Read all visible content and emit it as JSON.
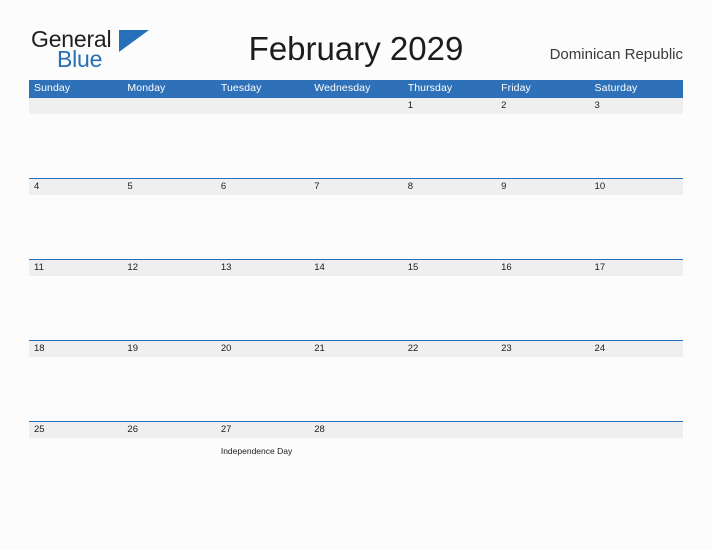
{
  "brand": {
    "name_part1": "General",
    "name_part2": "Blue",
    "icon": "blue-triangle-logo-mark",
    "color_primary": "#2570b8",
    "color_text": "#231f20"
  },
  "header": {
    "title": "February 2029",
    "region": "Dominican Republic"
  },
  "calendar": {
    "month": "February",
    "year": "2029",
    "header_background": "#2e71b8",
    "header_text_color": "#ffffff",
    "date_band_background": "#efefef",
    "row_border_color": "#2570b8",
    "weekdays": [
      "Sunday",
      "Monday",
      "Tuesday",
      "Wednesday",
      "Thursday",
      "Friday",
      "Saturday"
    ],
    "weeks": [
      {
        "days": [
          {
            "date": "",
            "events": []
          },
          {
            "date": "",
            "events": []
          },
          {
            "date": "",
            "events": []
          },
          {
            "date": "",
            "events": []
          },
          {
            "date": "1",
            "events": []
          },
          {
            "date": "2",
            "events": []
          },
          {
            "date": "3",
            "events": []
          }
        ]
      },
      {
        "days": [
          {
            "date": "4",
            "events": []
          },
          {
            "date": "5",
            "events": []
          },
          {
            "date": "6",
            "events": []
          },
          {
            "date": "7",
            "events": []
          },
          {
            "date": "8",
            "events": []
          },
          {
            "date": "9",
            "events": []
          },
          {
            "date": "10",
            "events": []
          }
        ]
      },
      {
        "days": [
          {
            "date": "11",
            "events": []
          },
          {
            "date": "12",
            "events": []
          },
          {
            "date": "13",
            "events": []
          },
          {
            "date": "14",
            "events": []
          },
          {
            "date": "15",
            "events": []
          },
          {
            "date": "16",
            "events": []
          },
          {
            "date": "17",
            "events": []
          }
        ]
      },
      {
        "days": [
          {
            "date": "18",
            "events": []
          },
          {
            "date": "19",
            "events": []
          },
          {
            "date": "20",
            "events": []
          },
          {
            "date": "21",
            "events": []
          },
          {
            "date": "22",
            "events": []
          },
          {
            "date": "23",
            "events": []
          },
          {
            "date": "24",
            "events": []
          }
        ]
      },
      {
        "days": [
          {
            "date": "25",
            "events": []
          },
          {
            "date": "26",
            "events": []
          },
          {
            "date": "27",
            "events": [
              "Independence Day"
            ]
          },
          {
            "date": "28",
            "events": []
          },
          {
            "date": "",
            "events": []
          },
          {
            "date": "",
            "events": []
          },
          {
            "date": "",
            "events": []
          }
        ]
      }
    ]
  }
}
